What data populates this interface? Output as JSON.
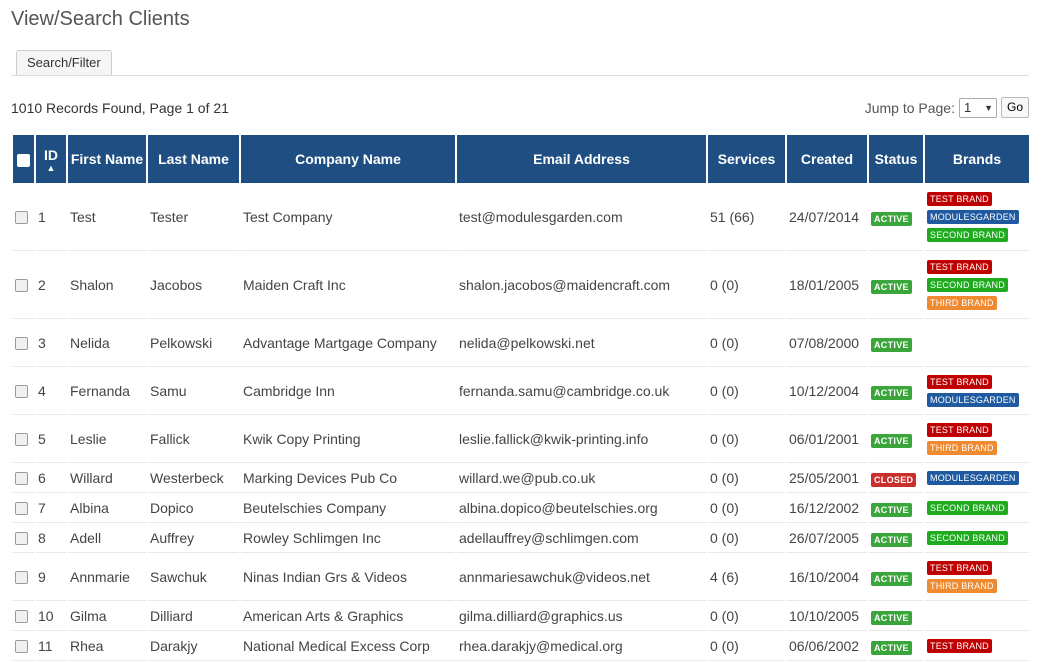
{
  "page": {
    "title": "View/Search Clients",
    "tab_label": "Search/Filter",
    "records_text": "1010 Records Found, Page 1 of 21",
    "jump_label": "Jump to Page:",
    "jump_value": "1",
    "go_label": "Go"
  },
  "table": {
    "headers": {
      "id": "ID",
      "first_name": "First Name",
      "last_name": "Last Name",
      "company": "Company Name",
      "email": "Email Address",
      "services": "Services",
      "created": "Created",
      "status": "Status",
      "brands": "Brands"
    },
    "rows": [
      {
        "id": "1",
        "first": "Test",
        "last": "Tester",
        "company": "Test Company",
        "email": "test@modulesgarden.com",
        "services": "51 (66)",
        "created": "24/07/2014",
        "status": "ACTIVE",
        "brands": [
          "TEST BRAND",
          "MODULESGARDEN",
          "SECOND BRAND"
        ],
        "h": 68
      },
      {
        "id": "2",
        "first": "Shalon",
        "last": "Jacobos",
        "company": "Maiden Craft Inc",
        "email": "shalon.jacobos@maidencraft.com",
        "services": "0 (0)",
        "created": "18/01/2005",
        "status": "ACTIVE",
        "brands": [
          "TEST BRAND",
          "SECOND BRAND",
          "THIRD BRAND"
        ],
        "h": 68
      },
      {
        "id": "3",
        "first": "Nelida",
        "last": "Pelkowski",
        "company": "Advantage Martgage Company",
        "email": "nelida@pelkowski.net",
        "services": "0 (0)",
        "created": "07/08/2000",
        "status": "ACTIVE",
        "brands": [],
        "h": 48
      },
      {
        "id": "4",
        "first": "Fernanda",
        "last": "Samu",
        "company": "Cambridge Inn",
        "email": "fernanda.samu@cambridge.co.uk",
        "services": "0 (0)",
        "created": "10/12/2004",
        "status": "ACTIVE",
        "brands": [
          "TEST BRAND",
          "MODULESGARDEN"
        ],
        "h": 48
      },
      {
        "id": "5",
        "first": "Leslie",
        "last": "Fallick",
        "company": "Kwik Copy Printing",
        "email": "leslie.fallick@kwik-printing.info",
        "services": "0 (0)",
        "created": "06/01/2001",
        "status": "ACTIVE",
        "brands": [
          "TEST BRAND",
          "THIRD BRAND"
        ],
        "h": 48
      },
      {
        "id": "6",
        "first": "Willard",
        "last": "Westerbeck",
        "company": "Marking Devices Pub Co",
        "email": "willard.we@pub.co.uk",
        "services": "0 (0)",
        "created": "25/05/2001",
        "status": "CLOSED",
        "brands": [
          "MODULESGARDEN"
        ],
        "h": 30
      },
      {
        "id": "7",
        "first": "Albina",
        "last": "Dopico",
        "company": "Beutelschies Company",
        "email": "albina.dopico@beutelschies.org",
        "services": "0 (0)",
        "created": "16/12/2002",
        "status": "ACTIVE",
        "brands": [
          "SECOND BRAND"
        ],
        "h": 30
      },
      {
        "id": "8",
        "first": "Adell",
        "last": "Auffrey",
        "company": "Rowley Schlimgen Inc",
        "email": "adellauffrey@schlimgen.com",
        "services": "0 (0)",
        "created": "26/07/2005",
        "status": "ACTIVE",
        "brands": [
          "SECOND BRAND"
        ],
        "h": 30
      },
      {
        "id": "9",
        "first": "Annmarie",
        "last": "Sawchuk",
        "company": "Ninas Indian Grs & Videos",
        "email": "annmariesawchuk@videos.net",
        "services": "4 (6)",
        "created": "16/10/2004",
        "status": "ACTIVE",
        "brands": [
          "TEST BRAND",
          "THIRD BRAND"
        ],
        "h": 48
      },
      {
        "id": "10",
        "first": "Gilma",
        "last": "Dilliard",
        "company": "American Arts & Graphics",
        "email": "gilma.dilliard@graphics.us",
        "services": "0 (0)",
        "created": "10/10/2005",
        "status": "ACTIVE",
        "brands": [],
        "h": 30
      },
      {
        "id": "11",
        "first": "Rhea",
        "last": "Darakjy",
        "company": "National Medical Excess Corp",
        "email": "rhea.darakjy@medical.org",
        "services": "0 (0)",
        "created": "06/06/2002",
        "status": "ACTIVE",
        "brands": [
          "TEST BRAND"
        ],
        "h": 30
      }
    ]
  },
  "colors": {
    "header_bg": "#1f4f82",
    "status": {
      "ACTIVE": "#3aa53a",
      "CLOSED": "#c9302c"
    },
    "brands": {
      "TEST BRAND": "#bf0000",
      "MODULESGARDEN": "#1f5aa0",
      "SECOND BRAND": "#1faa1f",
      "THIRD BRAND": "#f08a30"
    }
  }
}
